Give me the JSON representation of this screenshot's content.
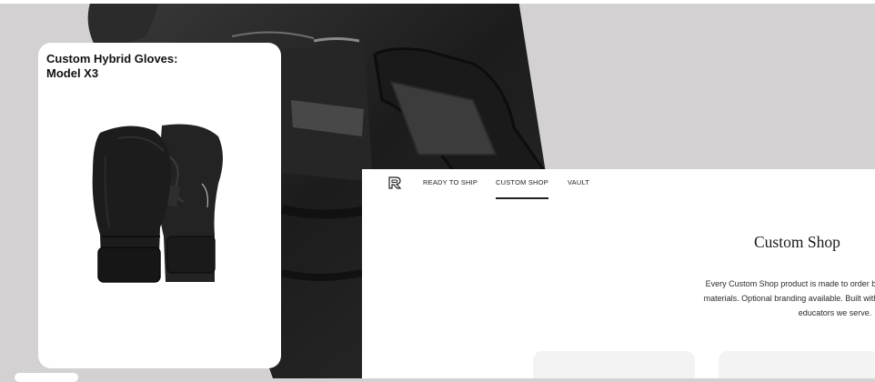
{
  "product_card": {
    "title": "Custom Hybrid Gloves:\nModel X3"
  },
  "nav": {
    "tabs": [
      {
        "label": "READY TO SHIP",
        "active": false
      },
      {
        "label": "CUSTOM SHOP",
        "active": true
      },
      {
        "label": "VAULT",
        "active": false
      }
    ]
  },
  "main": {
    "title": "Custom Shop",
    "description_lines": [
      "Every Custom Shop product is made to order by hand for each client. N",
      "materials. Optional branding available. Built with the same care and inter",
      "educators we serve."
    ]
  },
  "colors": {
    "background": "#d3d1d2",
    "glove": "#1e1e1e",
    "text": "#222222"
  }
}
